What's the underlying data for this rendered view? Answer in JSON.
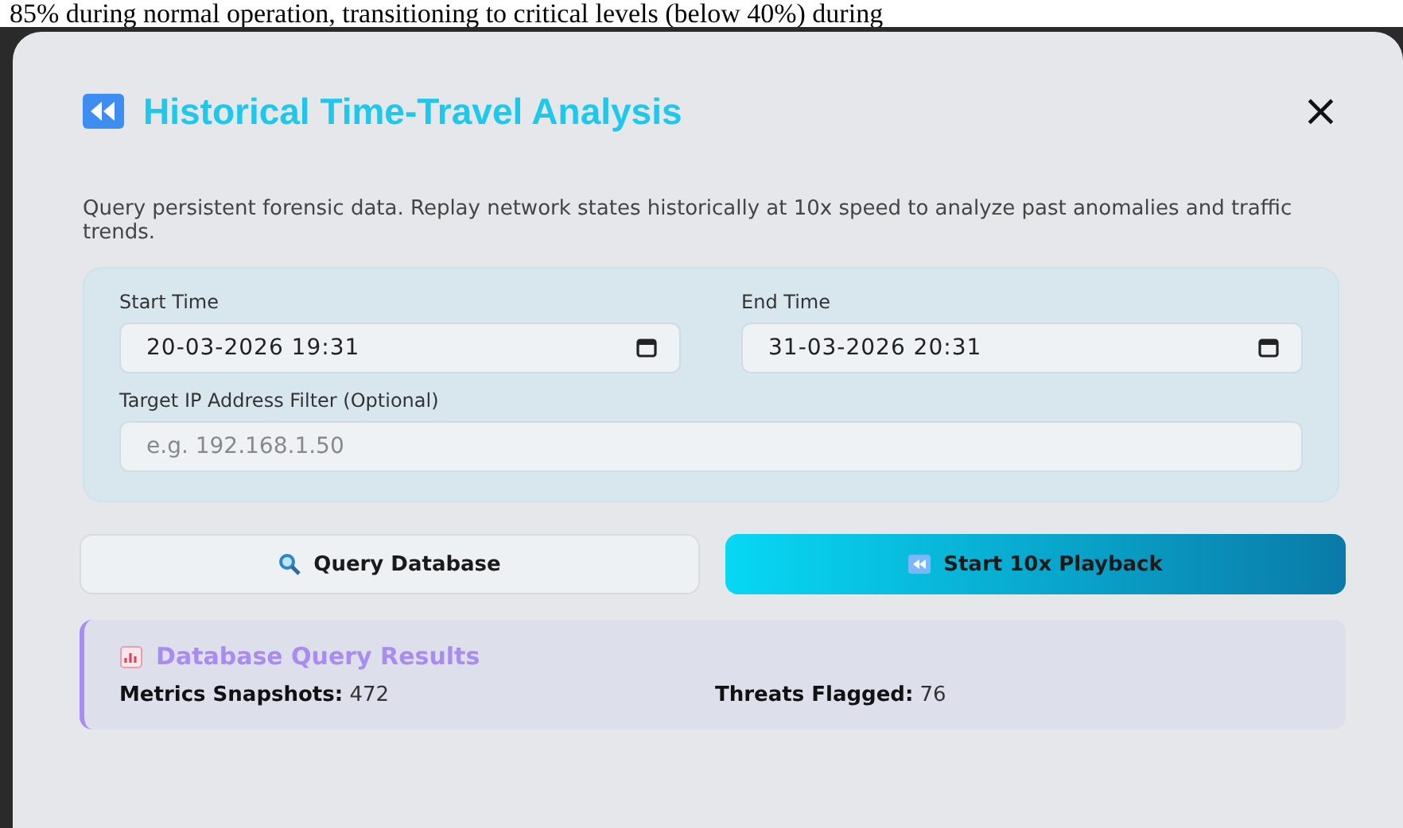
{
  "background_text": "85% during normal operation, transitioning to critical levels (below 40%) during",
  "dialog": {
    "title": "Historical Time-Travel Analysis",
    "close": "×",
    "description": "Query persistent forensic data. Replay network states historically at 10x speed to analyze past anomalies and traffic trends.",
    "fields": [
      {
        "kind": "datetime",
        "label": "Start Time",
        "value": "20-03-2026 19:31"
      },
      {
        "kind": "datetime",
        "label": "End Time",
        "value": "31-03-2026 20:31"
      },
      {
        "kind": "text",
        "label": "Target IP Address Filter (Optional)",
        "placeholder": "e.g. 192.168.1.50"
      }
    ],
    "buttons": [
      {
        "kind": "secondary",
        "label": "Query Database"
      },
      {
        "kind": "primary",
        "label": "Start 10x Playback"
      }
    ],
    "results": {
      "title": "Database Query Results",
      "stats": [
        {
          "label": "Metrics Snapshots:",
          "value": "472"
        },
        {
          "label": "Threats Flagged:",
          "value": "76"
        }
      ]
    }
  }
}
